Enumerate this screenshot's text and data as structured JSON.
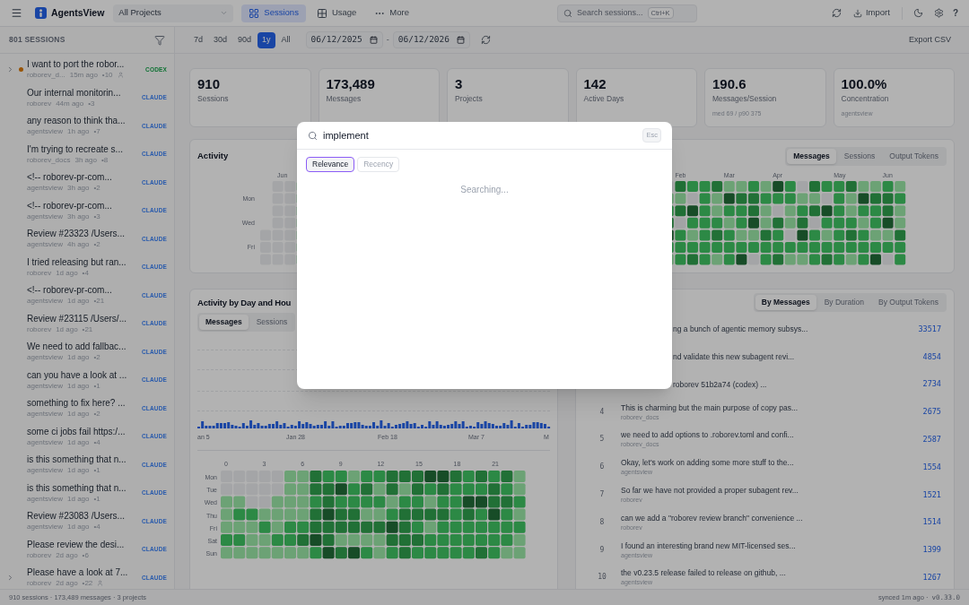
{
  "topbar": {
    "app_name": "AgentsView",
    "project_select": "All Projects",
    "nav": [
      {
        "label": "Sessions",
        "selected": true,
        "kind": "sessions"
      },
      {
        "label": "Usage",
        "selected": false,
        "kind": "usage"
      },
      {
        "label": "More",
        "selected": false,
        "kind": "more"
      }
    ],
    "search": {
      "placeholder": "Search sessions...",
      "shortcut": "Ctrl+K"
    },
    "import": "Import",
    "help": "?"
  },
  "sidebar": {
    "header": "801 SESSIONS",
    "sessions": [
      {
        "title": "I want to port the robor...",
        "project": "roborev_d...",
        "time": "15m ago",
        "count": "•10",
        "agent": "CODEX",
        "kind": "codex",
        "expandable": true,
        "running": true,
        "user_badge": true
      },
      {
        "title": "Our internal monitorin...",
        "project": "roborev",
        "time": "44m ago",
        "count": "•3",
        "agent": "CLAUDE",
        "kind": "claude",
        "expandable": false,
        "running": false,
        "user_badge": false
      },
      {
        "title": "any reason to think tha...",
        "project": "agentsview",
        "time": "1h ago",
        "count": "•7",
        "agent": "CLAUDE",
        "kind": "claude",
        "expandable": false,
        "running": false,
        "user_badge": false
      },
      {
        "title": "I'm trying to recreate s...",
        "project": "roborev_docs",
        "time": "3h ago",
        "count": "•8",
        "agent": "CLAUDE",
        "kind": "claude",
        "expandable": false,
        "running": false,
        "user_badge": false
      },
      {
        "title": "<!-- roborev-pr-com...",
        "project": "agentsview",
        "time": "3h ago",
        "count": "•2",
        "agent": "CLAUDE",
        "kind": "claude",
        "expandable": false,
        "running": false,
        "user_badge": false
      },
      {
        "title": "<!-- roborev-pr-com...",
        "project": "agentsview",
        "time": "3h ago",
        "count": "•3",
        "agent": "CLAUDE",
        "kind": "claude",
        "expandable": false,
        "running": false,
        "user_badge": false
      },
      {
        "title": "Review #23323 /Users...",
        "project": "agentsview",
        "time": "4h ago",
        "count": "•2",
        "agent": "CLAUDE",
        "kind": "claude",
        "expandable": false,
        "running": false,
        "user_badge": false
      },
      {
        "title": "I tried releasing but ran...",
        "project": "roborev",
        "time": "1d ago",
        "count": "•4",
        "agent": "CLAUDE",
        "kind": "claude",
        "expandable": false,
        "running": false,
        "user_badge": false
      },
      {
        "title": "<!-- roborev-pr-com...",
        "project": "agentsview",
        "time": "1d ago",
        "count": "•21",
        "agent": "CLAUDE",
        "kind": "claude",
        "expandable": false,
        "running": false,
        "user_badge": false
      },
      {
        "title": "Review #23115 /Users/...",
        "project": "roborev",
        "time": "1d ago",
        "count": "•21",
        "agent": "CLAUDE",
        "kind": "claude",
        "expandable": false,
        "running": false,
        "user_badge": false
      },
      {
        "title": "We need to add fallbac...",
        "project": "agentsview",
        "time": "1d ago",
        "count": "•2",
        "agent": "CLAUDE",
        "kind": "claude",
        "expandable": false,
        "running": false,
        "user_badge": false
      },
      {
        "title": "can you have a look at ...",
        "project": "agentsview",
        "time": "1d ago",
        "count": "•1",
        "agent": "CLAUDE",
        "kind": "claude",
        "expandable": false,
        "running": false,
        "user_badge": false
      },
      {
        "title": "something to fix here? ...",
        "project": "agentsview",
        "time": "1d ago",
        "count": "•2",
        "agent": "CLAUDE",
        "kind": "claude",
        "expandable": false,
        "running": false,
        "user_badge": false
      },
      {
        "title": "some ci jobs fail https:/...",
        "project": "agentsview",
        "time": "1d ago",
        "count": "•4",
        "agent": "CLAUDE",
        "kind": "claude",
        "expandable": false,
        "running": false,
        "user_badge": false
      },
      {
        "title": "is this something that n...",
        "project": "agentsview",
        "time": "1d ago",
        "count": "•1",
        "agent": "CLAUDE",
        "kind": "claude",
        "expandable": false,
        "running": false,
        "user_badge": false
      },
      {
        "title": "is this something that n...",
        "project": "agentsview",
        "time": "1d ago",
        "count": "•1",
        "agent": "CLAUDE",
        "kind": "claude",
        "expandable": false,
        "running": false,
        "user_badge": false
      },
      {
        "title": "Review #23083 /Users...",
        "project": "agentsview",
        "time": "1d ago",
        "count": "•4",
        "agent": "CLAUDE",
        "kind": "claude",
        "expandable": false,
        "running": false,
        "user_badge": false
      },
      {
        "title": "Please review the desi...",
        "project": "roborev",
        "time": "2d ago",
        "count": "•6",
        "agent": "CLAUDE",
        "kind": "claude",
        "expandable": false,
        "running": false,
        "user_badge": false
      },
      {
        "title": "Please have a look at 7...",
        "project": "roborev",
        "time": "2d ago",
        "count": "•22",
        "agent": "CLAUDE",
        "kind": "claude",
        "expandable": true,
        "running": false,
        "user_badge": true
      }
    ]
  },
  "toolbar": {
    "ranges": [
      {
        "label": "7d",
        "selected": false
      },
      {
        "label": "30d",
        "selected": false
      },
      {
        "label": "90d",
        "selected": false
      },
      {
        "label": "1y",
        "selected": true
      },
      {
        "label": "All",
        "selected": false
      }
    ],
    "date_from": "06/12/2025",
    "separator": "-",
    "date_to": "06/12/2026",
    "export": "Export CSV"
  },
  "stats": [
    {
      "value": "910",
      "label": "Sessions"
    },
    {
      "value": "173,489",
      "label": "Messages"
    },
    {
      "value": "3",
      "label": "Projects"
    },
    {
      "value": "142",
      "label": "Active Days"
    },
    {
      "value": "190.6",
      "label": "Messages/Session",
      "sub": "med 69 / p90 375"
    },
    {
      "value": "100.0%",
      "label": "Concentration",
      "sub": "agentsview"
    }
  ],
  "activity": {
    "title": "Activity",
    "tabs": [
      {
        "label": "Messages",
        "selected": true
      },
      {
        "label": "Sessions",
        "selected": false
      },
      {
        "label": "Output Tokens",
        "selected": false
      }
    ],
    "months": [
      "Jun",
      "Feb",
      "Mar",
      "Apr",
      "May",
      "Jun"
    ],
    "days": [
      "Mon",
      "Wed",
      "Fri"
    ]
  },
  "day_hour": {
    "title": "Activity by Day and Hou",
    "tabs": [
      {
        "label": "Messages",
        "selected": true
      },
      {
        "label": "Sessions",
        "selected": false
      }
    ],
    "x_labels": [
      "an 5",
      "Jan 28",
      "Feb 18",
      "Mar 7",
      "M"
    ],
    "hours": [
      "0",
      "3",
      "6",
      "9",
      "12",
      "15",
      "18",
      "21"
    ],
    "days": [
      "Mon",
      "Tue",
      "Wed",
      "Thu",
      "Fri",
      "Sat",
      "Sun"
    ]
  },
  "top_sessions": {
    "tabs": [
      {
        "label": "By Messages",
        "selected": true
      },
      {
        "label": "By Duration",
        "selected": false
      },
      {
        "label": "By Output Tokens",
        "selected": false
      }
    ],
    "rows": [
      {
        "title": "ng a bunch of agentic memory subsys...",
        "count": "33517"
      },
      {
        "title": "nd validate this new subagent revi...",
        "count": "4854"
      },
      {
        "title": "roborev 51b2a74 (codex) ...",
        "count": "2734"
      },
      {
        "rank": "4",
        "title": "This is charming but the main purpose of copy pas...",
        "project": "roborev_docs",
        "count": "2675"
      },
      {
        "rank": "5",
        "title": "we need to add options to .roborev.toml and confi...",
        "project": "roborev_docs",
        "count": "2587"
      },
      {
        "rank": "6",
        "title": "Okay, let's work on adding some more stuff to the...",
        "project": "agentsview",
        "count": "1554"
      },
      {
        "rank": "7",
        "title": "So far we have not provided a proper subagent rev...",
        "project": "roborev",
        "count": "1521"
      },
      {
        "rank": "8",
        "title": "can we add a \"roborev review branch\" convenience ...",
        "project": "roborev",
        "count": "1514"
      },
      {
        "rank": "9",
        "title": "I found an interesting brand new MIT-licensed ses...",
        "project": "agentsview",
        "count": "1399"
      },
      {
        "rank": "10",
        "title": "the v0.23.5 release failed to release on github, ...",
        "project": "agentsview",
        "count": "1267"
      }
    ]
  },
  "modal": {
    "query": "implement",
    "esc": "Esc",
    "sort": [
      {
        "label": "Relevance",
        "selected": true
      },
      {
        "label": "Recency",
        "selected": false
      }
    ],
    "status": "Searching..."
  },
  "status_bar": {
    "left": "910 sessions · 173,489 messages · 3 projects",
    "synced": "synced 1m ago ·",
    "version": "v0.33.0"
  }
}
